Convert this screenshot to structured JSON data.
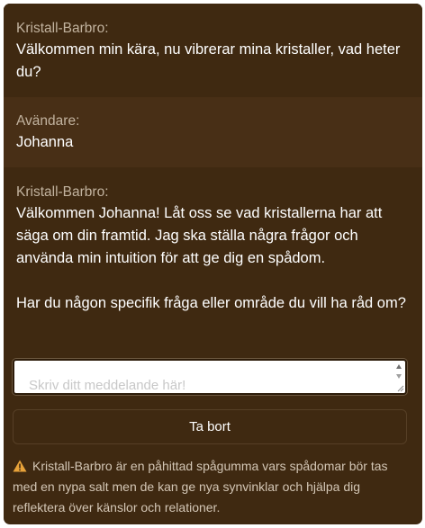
{
  "chat": {
    "messages": [
      {
        "sender": "Kristall-Barbro:",
        "text": "Välkommen min kära, nu vibrerar mina kristaller, vad heter du?"
      },
      {
        "sender": "Avändare:",
        "text": "Johanna"
      },
      {
        "sender": "Kristall-Barbro:",
        "text": "Välkommen Johanna! Låt oss se vad kristallerna har att säga om din framtid. Jag ska ställa några frågor och använda min intuition för att ge dig en spådom.\n\nHar du någon specifik fråga eller område du vill ha råd om?"
      }
    ]
  },
  "input": {
    "placeholder": "Skriv ditt meddelande här!",
    "value": ""
  },
  "actions": {
    "delete_label": "Ta bort"
  },
  "disclaimer": {
    "icon": "warning-icon",
    "text": "Kristall-Barbro är en påhittad spågumma vars spådomar bör tas med en nypa salt men de kan ge nya synvinklar och hjälpa dig reflektera över känslor och relationer."
  },
  "colors": {
    "panel_background": "#3f2911",
    "alt_message_background": "#482f16",
    "sender_label": "#c2b39f",
    "message_text": "#ffffff",
    "warning_accent": "#e8a33a"
  }
}
